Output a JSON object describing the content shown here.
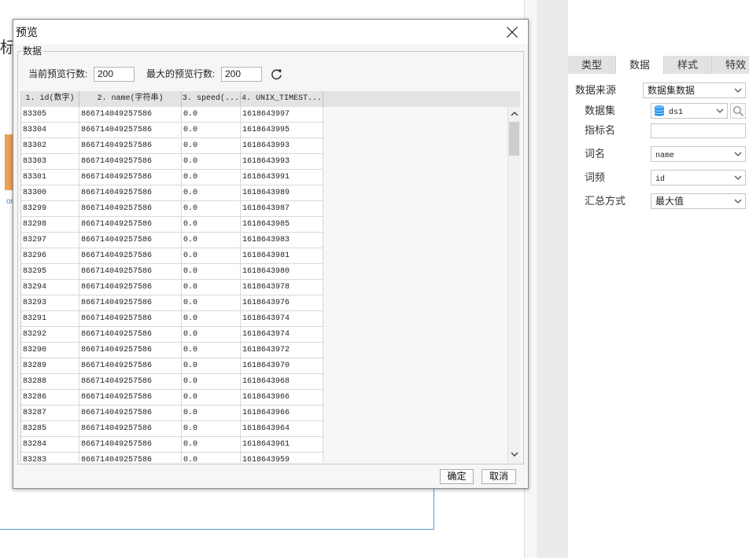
{
  "canvas": {
    "title_fragment": "标",
    "link_fragment": "or",
    "colors": {
      "accent_block": "#ee9f57",
      "frame_border": "#5a9bd8"
    }
  },
  "dialog": {
    "title": "预览",
    "group_label": "数据",
    "current_rows_label": "当前预览行数:",
    "current_rows_value": "200",
    "max_rows_label": "最大的预览行数:",
    "max_rows_value": "200",
    "icons": {
      "close": "close-icon",
      "refresh": "refresh-icon",
      "scroll_up": "chevron-up-icon",
      "scroll_down": "chevron-down-icon"
    },
    "table": {
      "columns": [
        "1. id(数字)",
        "2. name(字符串)",
        "3. speed(...",
        "4. UNIX_TIMEST..."
      ],
      "rows": [
        [
          "83305",
          "866714049257586",
          "0.0",
          "1618643997"
        ],
        [
          "83304",
          "866714049257586",
          "0.0",
          "1618643995"
        ],
        [
          "83302",
          "866714049257586",
          "0.0",
          "1618643993"
        ],
        [
          "83303",
          "866714049257586",
          "0.0",
          "1618643993"
        ],
        [
          "83301",
          "866714049257586",
          "0.0",
          "1618643991"
        ],
        [
          "83300",
          "866714049257586",
          "0.0",
          "1618643989"
        ],
        [
          "83299",
          "866714049257586",
          "0.0",
          "1618643987"
        ],
        [
          "83298",
          "866714049257586",
          "0.0",
          "1618643985"
        ],
        [
          "83297",
          "866714049257586",
          "0.0",
          "1618643983"
        ],
        [
          "83296",
          "866714049257586",
          "0.0",
          "1618643981"
        ],
        [
          "83295",
          "866714049257586",
          "0.0",
          "1618643980"
        ],
        [
          "83294",
          "866714049257586",
          "0.0",
          "1618643978"
        ],
        [
          "83293",
          "866714049257586",
          "0.0",
          "1618643976"
        ],
        [
          "83291",
          "866714049257586",
          "0.0",
          "1618643974"
        ],
        [
          "83292",
          "866714049257586",
          "0.0",
          "1618643974"
        ],
        [
          "83290",
          "866714049257586",
          "0.0",
          "1618643972"
        ],
        [
          "83289",
          "866714049257586",
          "0.0",
          "1618643970"
        ],
        [
          "83288",
          "866714049257586",
          "0.0",
          "1618643968"
        ],
        [
          "83286",
          "866714049257586",
          "0.0",
          "1618643966"
        ],
        [
          "83287",
          "866714049257586",
          "0.0",
          "1618643966"
        ],
        [
          "83285",
          "866714049257586",
          "0.0",
          "1618643964"
        ],
        [
          "83284",
          "866714049257586",
          "0.0",
          "1618643961"
        ],
        [
          "83283",
          "866714049257586",
          "0.0",
          "1618643959"
        ]
      ]
    },
    "ok_label": "确定",
    "cancel_label": "取消"
  },
  "panel": {
    "tabs": [
      {
        "label": "类型"
      },
      {
        "label": "数据",
        "active": true
      },
      {
        "label": "样式"
      },
      {
        "label": "特效"
      }
    ],
    "fields": {
      "data_source": {
        "label": "数据来源",
        "value": "数据集数据"
      },
      "dataset": {
        "label": "数据集",
        "value": "ds1",
        "icon": "database-icon",
        "search_icon": "search-icon"
      },
      "indicator_name": {
        "label": "指标名",
        "value": ""
      },
      "word_name": {
        "label": "词名",
        "value": "name"
      },
      "word_freq": {
        "label": "词频",
        "value": "id"
      },
      "summary": {
        "label": "汇总方式",
        "value": "最大值"
      }
    },
    "colors": {
      "database_icon": "#2196f3"
    }
  }
}
